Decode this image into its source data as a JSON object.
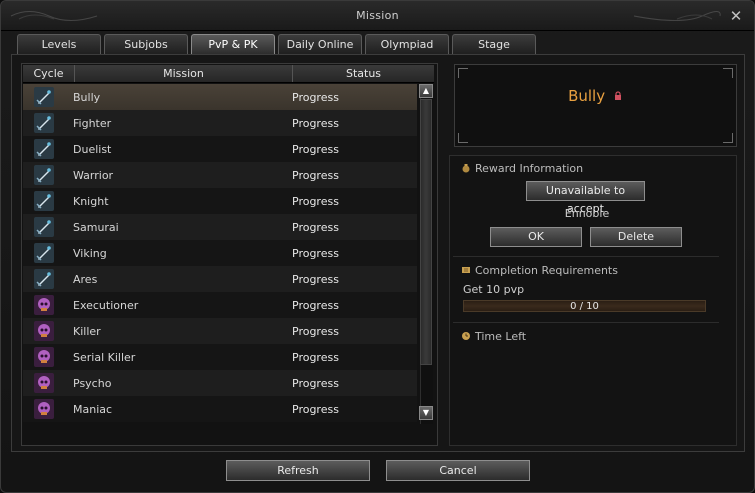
{
  "window": {
    "title": "Mission"
  },
  "tabs": [
    {
      "label": "Levels",
      "active": false
    },
    {
      "label": "Subjobs",
      "active": false
    },
    {
      "label": "PvP & PK",
      "active": true
    },
    {
      "label": "Daily Online",
      "active": false
    },
    {
      "label": "Olympiad",
      "active": false
    },
    {
      "label": "Stage",
      "active": false
    }
  ],
  "list": {
    "headers": {
      "cycle": "Cycle",
      "mission": "Mission",
      "status": "Status"
    },
    "rows": [
      {
        "name": "Bully",
        "status": "Progress",
        "icon": "sword-icon",
        "selected": true
      },
      {
        "name": "Fighter",
        "status": "Progress",
        "icon": "sword-icon"
      },
      {
        "name": "Duelist",
        "status": "Progress",
        "icon": "sword-icon"
      },
      {
        "name": "Warrior",
        "status": "Progress",
        "icon": "sword-icon"
      },
      {
        "name": "Knight",
        "status": "Progress",
        "icon": "sword-icon"
      },
      {
        "name": "Samurai",
        "status": "Progress",
        "icon": "sword-icon"
      },
      {
        "name": "Viking",
        "status": "Progress",
        "icon": "sword-icon"
      },
      {
        "name": "Ares",
        "status": "Progress",
        "icon": "sword-icon"
      },
      {
        "name": "Executioner",
        "status": "Progress",
        "icon": "skull-icon"
      },
      {
        "name": "Killer",
        "status": "Progress",
        "icon": "skull-icon"
      },
      {
        "name": "Serial Killer",
        "status": "Progress",
        "icon": "skull-icon"
      },
      {
        "name": "Psycho",
        "status": "Progress",
        "icon": "skull-icon"
      },
      {
        "name": "Maniac",
        "status": "Progress",
        "icon": "skull-icon"
      }
    ]
  },
  "detail": {
    "mission_title": "Bully",
    "reward_header": "Reward Information",
    "unavailable_label": "Unavailable to accept",
    "reward_name": "Ennoble",
    "ok_label": "OK",
    "delete_label": "Delete",
    "requirements_header": "Completion Requirements",
    "requirement_text": "Get 10 pvp",
    "progress_text": "0 / 10",
    "progress_value": 0,
    "progress_max": 10,
    "time_left_header": "Time Left"
  },
  "footer": {
    "refresh_label": "Refresh",
    "cancel_label": "Cancel"
  },
  "colors": {
    "accent_title": "#e8a040",
    "lock": "#d05060"
  }
}
